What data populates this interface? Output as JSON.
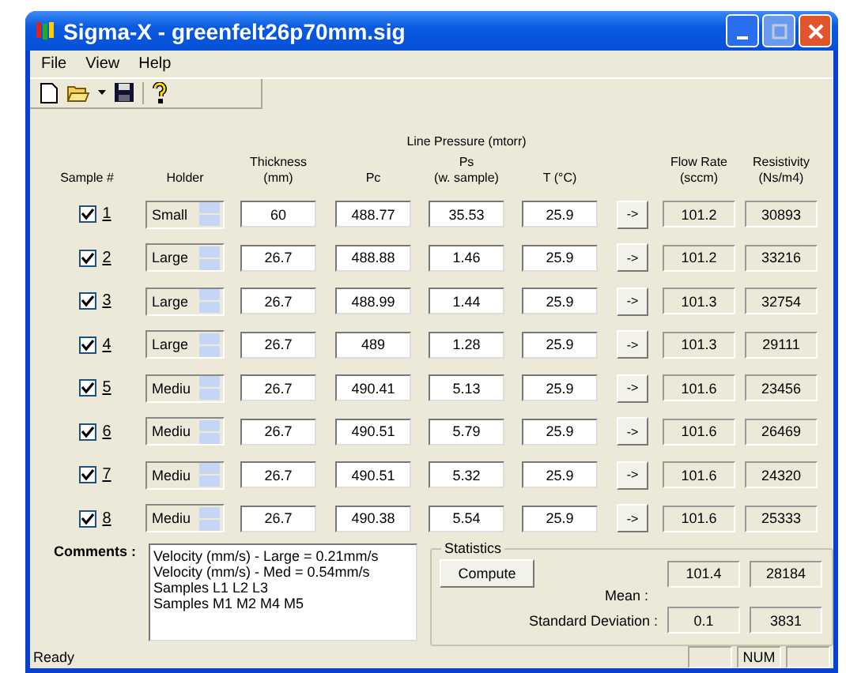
{
  "window": {
    "title": "Sigma-X - greenfelt26p70mm.sig"
  },
  "menu": [
    {
      "label": "File"
    },
    {
      "label": "View"
    },
    {
      "label": "Help"
    }
  ],
  "table": {
    "group_header": "Line Pressure (mtorr)",
    "columns": [
      {
        "lines": [
          "Sample #"
        ]
      },
      {
        "lines": [
          "Holder"
        ]
      },
      {
        "lines": [
          "Thickness",
          "(mm)"
        ]
      },
      {
        "lines": [
          "Pc"
        ]
      },
      {
        "lines": [
          "Ps",
          "(w. sample)"
        ]
      },
      {
        "lines": [
          "T (°C)"
        ]
      },
      {},
      {
        "lines": [
          "Flow Rate",
          "(sccm)"
        ]
      },
      {
        "lines": [
          "Resistivity",
          "(Ns/m4)"
        ]
      }
    ],
    "rows": [
      {
        "checked": true,
        "number": "1",
        "holder": "Small",
        "thickness": "60",
        "pc": "488.77",
        "ps": "35.53",
        "t": "25.9",
        "button": "->",
        "flow_rate": "101.2",
        "resistivity": "30893"
      },
      {
        "checked": true,
        "number": "2",
        "holder": "Large",
        "thickness": "26.7",
        "pc": "488.88",
        "ps": "1.46",
        "t": "25.9",
        "button": "->",
        "flow_rate": "101.2",
        "resistivity": "33216"
      },
      {
        "checked": true,
        "number": "3",
        "holder": "Large",
        "thickness": "26.7",
        "pc": "488.99",
        "ps": "1.44",
        "t": "25.9",
        "button": "->",
        "flow_rate": "101.3",
        "resistivity": "32754"
      },
      {
        "checked": true,
        "number": "4",
        "holder": "Large",
        "thickness": "26.7",
        "pc": "489",
        "ps": "1.28",
        "t": "25.9",
        "button": "->",
        "flow_rate": "101.3",
        "resistivity": "29111"
      },
      {
        "checked": true,
        "number": "5",
        "holder": "Mediu",
        "thickness": "26.7",
        "pc": "490.41",
        "ps": "5.13",
        "t": "25.9",
        "button": "->",
        "flow_rate": "101.6",
        "resistivity": "23456"
      },
      {
        "checked": true,
        "number": "6",
        "holder": "Mediu",
        "thickness": "26.7",
        "pc": "490.51",
        "ps": "5.79",
        "t": "25.9",
        "button": "->",
        "flow_rate": "101.6",
        "resistivity": "26469"
      },
      {
        "checked": true,
        "number": "7",
        "holder": "Mediu",
        "thickness": "26.7",
        "pc": "490.51",
        "ps": "5.32",
        "t": "25.9",
        "button": "->",
        "flow_rate": "101.6",
        "resistivity": "24320"
      },
      {
        "checked": true,
        "number": "8",
        "holder": "Mediu",
        "thickness": "26.7",
        "pc": "490.38",
        "ps": "5.54",
        "t": "25.9",
        "button": "->",
        "flow_rate": "101.6",
        "resistivity": "25333"
      }
    ]
  },
  "comments": {
    "label": "Comments :",
    "lines": [
      "Velocity (mm/s) - Large = 0.21mm/s",
      "Velocity (mm/s) - Med = 0.54mm/s",
      "Samples L1 L2 L3",
      "Samples M1 M2 M4 M5"
    ]
  },
  "statistics": {
    "title": "Statistics",
    "compute": "Compute",
    "mean_label": "Mean :",
    "mean": [
      "101.4",
      "28184"
    ],
    "std_label": "Standard Deviation :",
    "std": [
      "0.1",
      "3831"
    ]
  },
  "status_bar": {
    "text": "Ready",
    "indicator": "NUM"
  }
}
